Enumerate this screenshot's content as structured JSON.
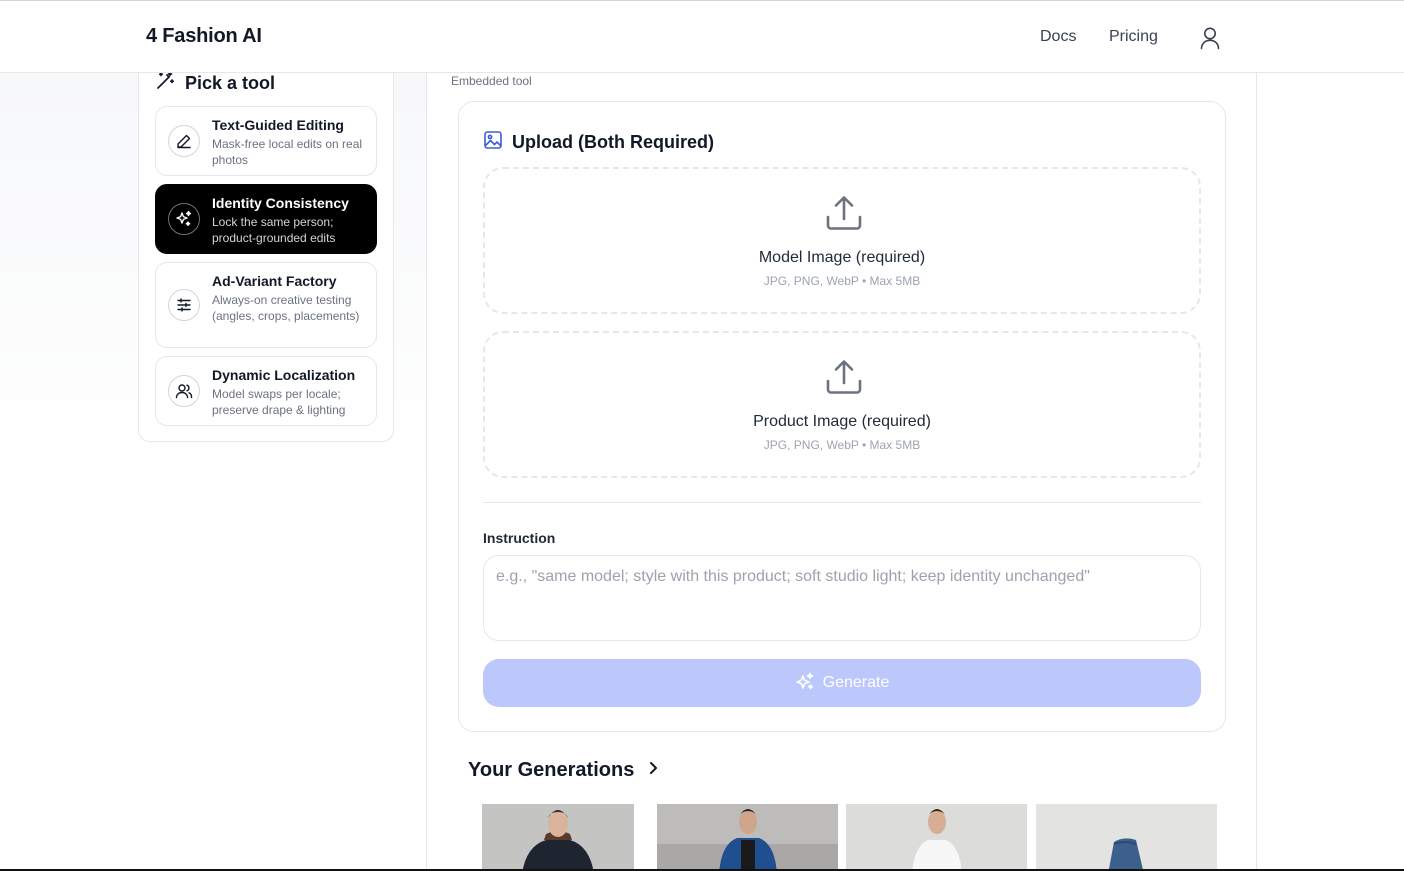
{
  "header": {
    "logo": "4 Fashion AI",
    "nav": [
      {
        "label": "Docs"
      },
      {
        "label": "Pricing"
      }
    ],
    "user_icon": "user-icon"
  },
  "sidebar": {
    "title": "Pick a tool",
    "title_icon": "magic-wand-icon",
    "tools": [
      {
        "name": "Text-Guided Editing",
        "desc": "Mask-free local edits on real photos",
        "icon": "pencil-icon",
        "active": false
      },
      {
        "name": "Identity Consistency",
        "desc": "Lock the same person; product-grounded edits",
        "icon": "sparkles-icon",
        "active": true
      },
      {
        "name": "Ad-Variant Factory",
        "desc": "Always-on creative testing (angles, crops, placements)",
        "icon": "sliders-icon",
        "active": false
      },
      {
        "name": "Dynamic Localization",
        "desc": "Model swaps per locale; preserve drape & lighting",
        "icon": "users-icon",
        "active": false
      }
    ]
  },
  "main": {
    "embedded_label": "Embedded tool",
    "upload_title": "Upload (Both Required)",
    "upload_icon": "image-icon",
    "dropzones": [
      {
        "title": "Model Image (required)",
        "sub": "JPG, PNG, WebP • Max 5MB"
      },
      {
        "title": "Product Image (required)",
        "sub": "JPG, PNG, WebP • Max 5MB"
      }
    ],
    "instruction_label": "Instruction",
    "instruction_placeholder": "e.g., \"same model; style with this product; soft studio light; keep identity unchanged\"",
    "instruction_value": "",
    "generate_label": "Generate",
    "generations_title": "Your Generations"
  },
  "colors": {
    "accent_disabled": "#bcc8fb",
    "active_tool_bg": "#000000",
    "icon_blue": "#3b5bdb"
  }
}
